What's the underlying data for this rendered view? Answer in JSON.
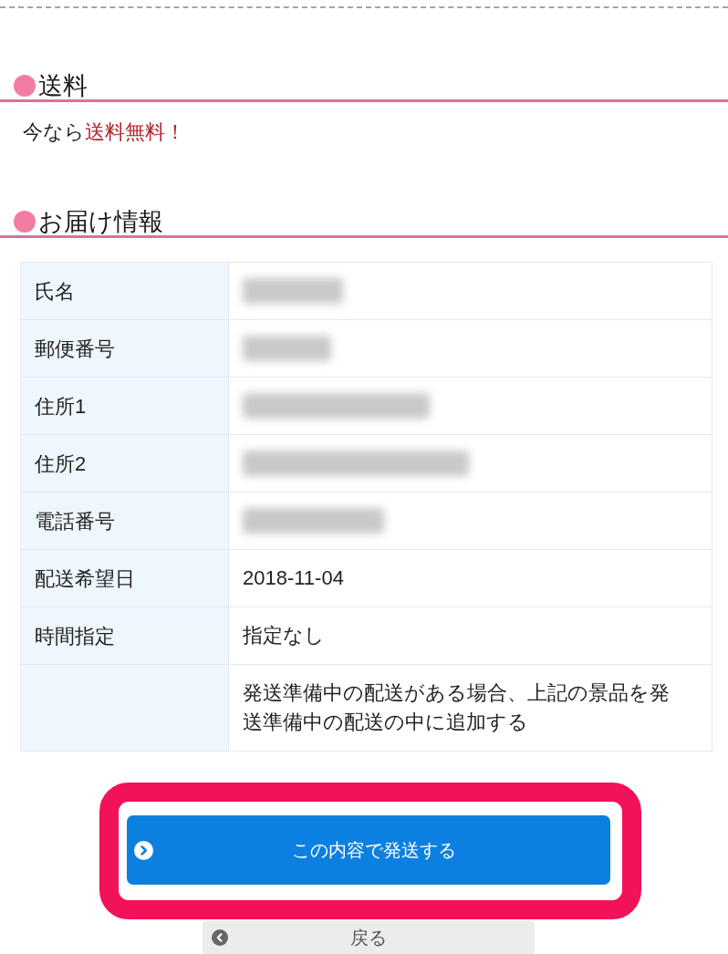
{
  "sections": [
    {
      "kind": "notice",
      "title": "送料",
      "segments": [
        {
          "text": "今なら",
          "highlighted": false
        },
        {
          "text": "送料無料！",
          "highlighted": true
        }
      ]
    },
    {
      "kind": "table",
      "title": "お届け情報",
      "rows": [
        {
          "label": "氏名",
          "kind": "blurred"
        },
        {
          "label": "郵便番号",
          "kind": "blurred"
        },
        {
          "label": "住所1",
          "kind": "blurred"
        },
        {
          "label": "住所2",
          "kind": "blurred"
        },
        {
          "label": "電話番号",
          "kind": "blurred"
        },
        {
          "label": "配送希望日",
          "kind": "text",
          "value": "2018-11-04"
        },
        {
          "label": "時間指定",
          "kind": "text",
          "value": "指定なし"
        },
        {
          "kind": "text",
          "value": "発送準備中の配送がある場合、上記の景品を発送準備中の配送の中に追加する"
        }
      ]
    }
  ],
  "submit_button": {
    "label": "この内容で発送する",
    "highlighted": true
  },
  "back_button": {
    "label": "戻る"
  }
}
